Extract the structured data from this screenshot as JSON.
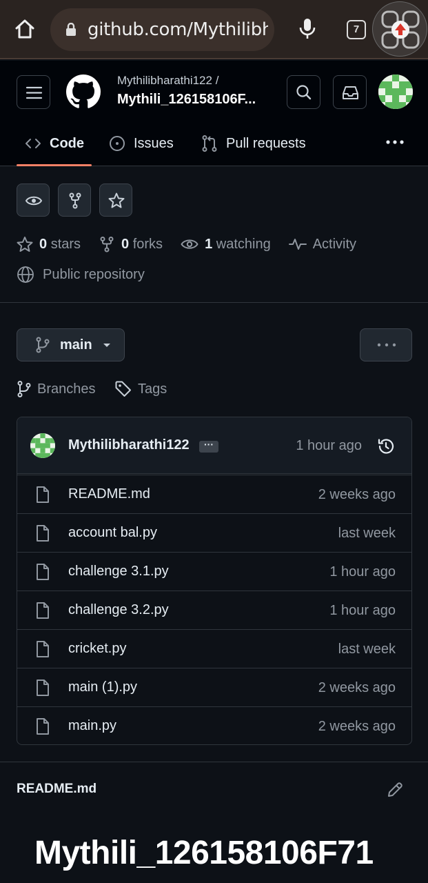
{
  "browser": {
    "url": "github.com/Mythilibh",
    "tab_count": "7"
  },
  "header": {
    "owner": "Mythilibharathi122 /",
    "repo": "Mythili_126158106F..."
  },
  "tabs": [
    {
      "label": "Code"
    },
    {
      "label": "Issues"
    },
    {
      "label": "Pull requests"
    }
  ],
  "stats": {
    "stars_count": "0",
    "stars_label": "stars",
    "forks_count": "0",
    "forks_label": "forks",
    "watching_count": "1",
    "watching_label": "watching",
    "activity_label": "Activity",
    "visibility": "Public repository"
  },
  "branch": {
    "current": "main",
    "branches_label": "Branches",
    "tags_label": "Tags"
  },
  "commit": {
    "author": "Mythilibharathi122",
    "time": "1 hour ago",
    "ellipsis": "···"
  },
  "files": [
    {
      "name": "README.md",
      "time": "2 weeks ago"
    },
    {
      "name": "account bal.py",
      "time": "last week"
    },
    {
      "name": "challenge 3.1.py",
      "time": "1 hour ago"
    },
    {
      "name": "challenge 3.2.py",
      "time": "1 hour ago"
    },
    {
      "name": "cricket.py",
      "time": "last week"
    },
    {
      "name": "main (1).py",
      "time": "2 weeks ago"
    },
    {
      "name": "main.py",
      "time": "2 weeks ago"
    }
  ],
  "readme": {
    "file_label": "README.md",
    "heading": "Mythili_126158106F71"
  },
  "colors": {
    "background": "#0d1117",
    "header_bg": "#010409",
    "accent_underline": "#f78166",
    "muted_text": "#9198a1",
    "avatar_green": "#5cb85c"
  }
}
